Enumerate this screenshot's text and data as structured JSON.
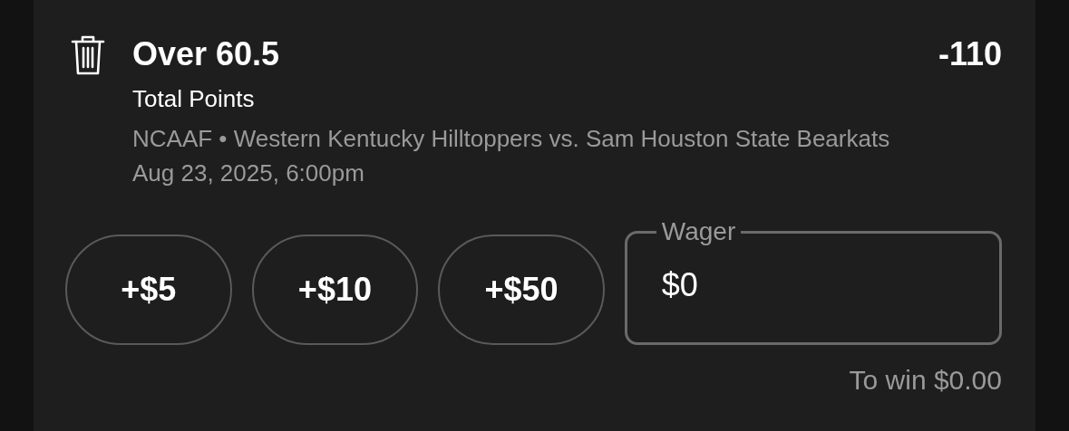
{
  "bet": {
    "selection": "Over 60.5",
    "odds": "-110",
    "market": "Total Points",
    "event": "NCAAF • Western Kentucky Hilltoppers vs. Sam Houston State Bearkats Aug 23, 2025, 6:00pm"
  },
  "quick_amounts": [
    "+$5",
    "+$10",
    "+$50"
  ],
  "wager": {
    "label": "Wager",
    "value": "$0"
  },
  "to_win": "To win $0.00"
}
